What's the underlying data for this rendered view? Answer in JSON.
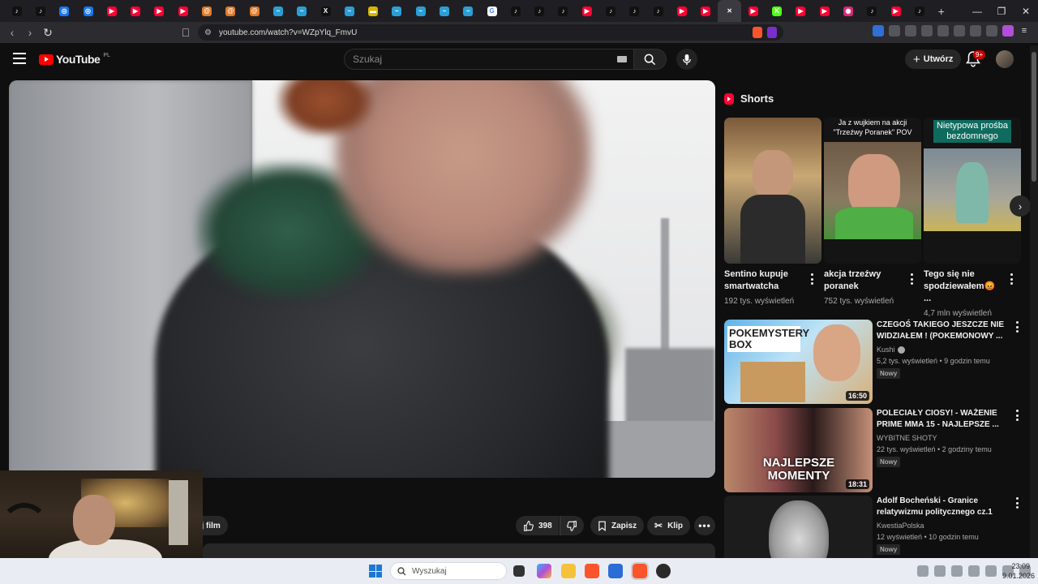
{
  "browser": {
    "tabs": [
      {
        "icon": "tiktok-icon",
        "color": "#111111",
        "glyph": "♪"
      },
      {
        "icon": "tiktok-icon",
        "color": "#111111",
        "glyph": "♪"
      },
      {
        "icon": "messenger-icon",
        "color": "#1877f2",
        "glyph": "◎"
      },
      {
        "icon": "messenger-icon",
        "color": "#1877f2",
        "glyph": "◎"
      },
      {
        "icon": "youtube-icon",
        "color": "#ff0033",
        "glyph": "▶"
      },
      {
        "icon": "youtube-icon",
        "color": "#ff0033",
        "glyph": "▶"
      },
      {
        "icon": "youtube-icon",
        "color": "#ff0033",
        "glyph": "▶"
      },
      {
        "icon": "youtube-icon",
        "color": "#ff0033",
        "glyph": "▶"
      },
      {
        "icon": "spiral-icon",
        "color": "#e07a2a",
        "glyph": "@"
      },
      {
        "icon": "spiral-icon",
        "color": "#e07a2a",
        "glyph": "@"
      },
      {
        "icon": "spiral-icon",
        "color": "#e07a2a",
        "glyph": "@"
      },
      {
        "icon": "chart-icon",
        "color": "#2a9fd6",
        "glyph": "~"
      },
      {
        "icon": "chart-icon",
        "color": "#2a9fd6",
        "glyph": "~"
      },
      {
        "icon": "x-icon",
        "color": "#111111",
        "glyph": "X"
      },
      {
        "icon": "chart-icon",
        "color": "#2a9fd6",
        "glyph": "~"
      },
      {
        "icon": "flag-icon",
        "color": "#d9b400",
        "glyph": "▬"
      },
      {
        "icon": "chart-icon",
        "color": "#2a9fd6",
        "glyph": "~"
      },
      {
        "icon": "chart-icon",
        "color": "#2a9fd6",
        "glyph": "~"
      },
      {
        "icon": "chart-icon",
        "color": "#2a9fd6",
        "glyph": "~"
      },
      {
        "icon": "chart-icon",
        "color": "#2a9fd6",
        "glyph": "~"
      },
      {
        "icon": "google-icon",
        "color": "#ffffff",
        "glyph": "G"
      },
      {
        "icon": "tiktok-icon",
        "color": "#111111",
        "glyph": "♪"
      },
      {
        "icon": "tiktok-icon",
        "color": "#111111",
        "glyph": "♪"
      },
      {
        "icon": "tiktok-icon",
        "color": "#111111",
        "glyph": "♪"
      },
      {
        "icon": "youtube-icon",
        "color": "#ff0033",
        "glyph": "▶"
      },
      {
        "icon": "tiktok-icon",
        "color": "#111111",
        "glyph": "♪"
      },
      {
        "icon": "tiktok-icon",
        "color": "#111111",
        "glyph": "♪"
      },
      {
        "icon": "tiktok-icon",
        "color": "#111111",
        "glyph": "♪"
      },
      {
        "icon": "youtube-icon",
        "color": "#ff0033",
        "glyph": "▶"
      },
      {
        "icon": "youtube-icon",
        "color": "#ff0033",
        "glyph": "▶"
      },
      {
        "icon": "close-icon",
        "color": "#3a3a40",
        "glyph": "✕",
        "active": true
      },
      {
        "icon": "youtube-icon",
        "color": "#ff0033",
        "glyph": "▶"
      },
      {
        "icon": "kick-icon",
        "color": "#53fc18",
        "glyph": "K"
      },
      {
        "icon": "youtube-icon",
        "color": "#ff0033",
        "glyph": "▶"
      },
      {
        "icon": "youtube-icon",
        "color": "#ff0033",
        "glyph": "▶"
      },
      {
        "icon": "instagram-icon",
        "color": "#d62976",
        "glyph": "◉"
      },
      {
        "icon": "tiktok-icon",
        "color": "#111111",
        "glyph": "♪"
      },
      {
        "icon": "youtube-icon",
        "color": "#ff0033",
        "glyph": "▶"
      },
      {
        "icon": "tiktok-icon",
        "color": "#111111",
        "glyph": "♪"
      }
    ],
    "new_tab": "+",
    "url": "youtube.com/watch?v=WZpYlq_FmvU"
  },
  "header": {
    "logo_text": "YouTube",
    "logo_region": "PL",
    "search_placeholder": "Szukaj",
    "create_label": "Utwórz",
    "notifications_badge": "9+"
  },
  "actions": {
    "share_label": "tuj film",
    "like_count": "398",
    "save_label": "Zapisz",
    "clip_label": "Klip"
  },
  "shorts": {
    "heading": "Shorts",
    "items": [
      {
        "title": "Sentino kupuje smartwatcha",
        "views": "192 tys. wyświetleń",
        "overlay": ""
      },
      {
        "title": "akcja trzeźwy poranek",
        "views": "752 tys. wyświetleń",
        "overlay": "Ja z wujkiem na akcji \"Trzeźwy Poranek\" POV"
      },
      {
        "title": "Tego się nie spodziewałem😡 ...",
        "views": "4,7 mln wyświetleń",
        "overlay": "Nietypowa prośba bezdomnego"
      }
    ]
  },
  "recommendations": [
    {
      "title": "CZEGOŚ TAKIEGO JESZCZE NIE WIDZIAŁEM ! (POKEMONOWY ...",
      "channel": "Kushi",
      "verified": true,
      "meta": "5,2 tys. wyświetleń • 9 godzin temu",
      "badge": "Nowy",
      "duration": "16:50",
      "thumb_text": "POKEMYSTERY BOX"
    },
    {
      "title": "POLECIAŁY CIOSY! - WAŻENIE PRIME MMA 15 - NAJLEPSZE ...",
      "channel": "WYBITNE SHOTY",
      "verified": false,
      "meta": "22 tys. wyświetleń • 2 godziny temu",
      "badge": "Nowy",
      "duration": "18:31",
      "thumb_text": "NAJLEPSZE MOMENTY"
    },
    {
      "title": "Adolf Bocheński -  Granice relatywizmu politycznego cz.1",
      "channel": "KwestiaPolska",
      "verified": false,
      "meta": "12 wyświetleń • 10 godzin temu",
      "badge": "Nowy",
      "duration": "",
      "thumb_text": ""
    }
  ],
  "taskbar": {
    "search_placeholder": "Wyszukaj",
    "time": "23:09",
    "date": "9.01.2026"
  }
}
